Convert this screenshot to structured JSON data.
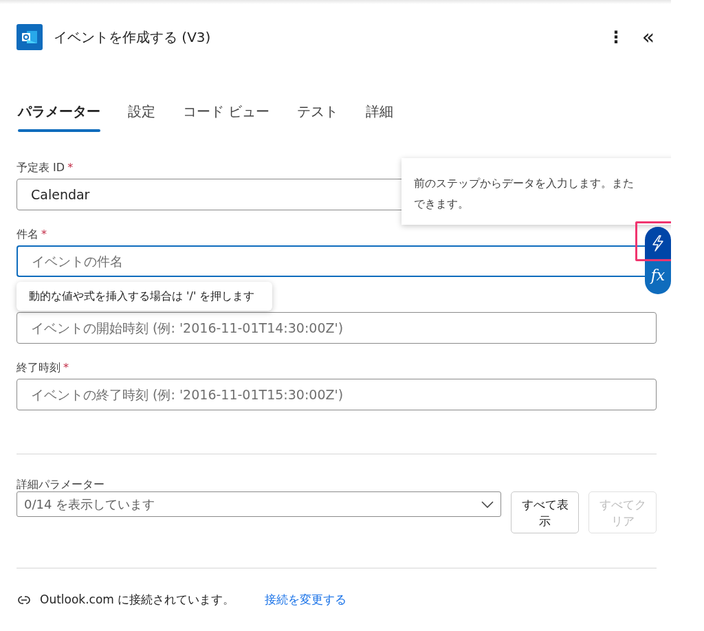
{
  "header": {
    "title": "イベントを作成する (V3)",
    "more": "⋮",
    "collapse": "«"
  },
  "tabs": [
    {
      "label": "パラメーター",
      "selected": true
    },
    {
      "label": "設定",
      "selected": false
    },
    {
      "label": "コード ビュー",
      "selected": false
    },
    {
      "label": "テスト",
      "selected": false
    },
    {
      "label": "詳細",
      "selected": false
    }
  ],
  "fields": [
    {
      "label": "予定表 ID",
      "required_mark": "*",
      "value": "Calendar",
      "focused": false
    },
    {
      "label": "件名",
      "required_mark": "*",
      "placeholder": "イベントの件名",
      "focused": true
    },
    {
      "placeholder": "イベントの開始時刻 (例: '2016-11-01T14:30:00Z')",
      "focused": false
    },
    {
      "label": "終了時刻",
      "required_mark": "*",
      "placeholder": "イベントの終了時刻 (例: '2016-11-01T15:30:00Z')",
      "focused": false
    }
  ],
  "hint_tooltip": {
    "text": "動的な値や式を挿入する場合は '/' を押します"
  },
  "dynamic_tooltip": {
    "lines": [
      "前のステップからデータを入力します。また",
      "できます。"
    ]
  },
  "insert_buttons": [
    {
      "kind": "dynamic",
      "highlighted": true
    },
    {
      "kind": "expression",
      "label": "fx",
      "highlighted": false
    }
  ],
  "advanced": {
    "label": "詳細パラメーター",
    "value": "0/14 を表示しています",
    "buttons": [
      {
        "label": "すべて表示",
        "disabled": false
      },
      {
        "label": "すべてクリア",
        "disabled": true
      }
    ]
  },
  "footer": {
    "text": "Outlook.com に接続されています。",
    "link": "接続を変更する"
  }
}
